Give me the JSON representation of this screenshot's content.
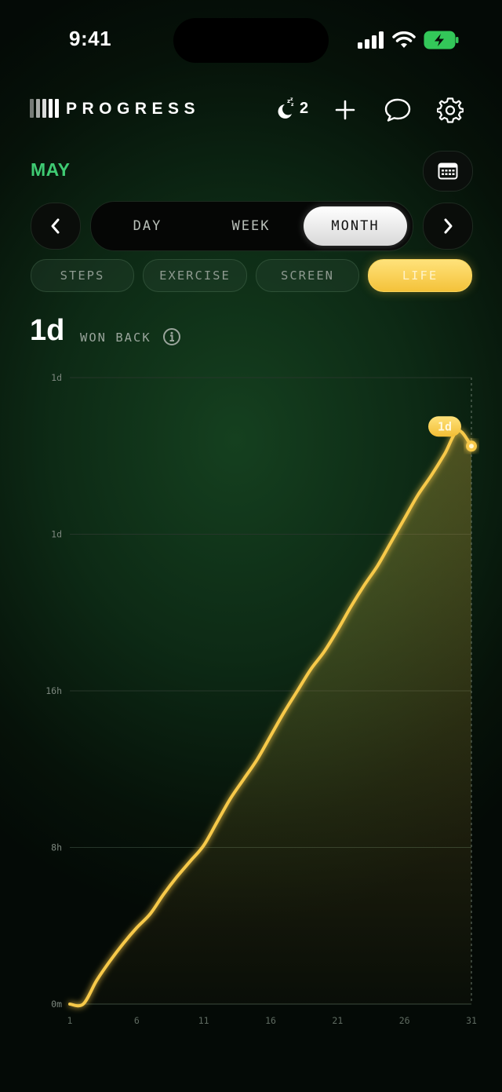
{
  "status_bar": {
    "time": "9:41"
  },
  "header": {
    "title": "PROGRESS",
    "sleep_count": "2",
    "icons": [
      "moon-sleep-icon",
      "plus-icon",
      "chat-bubble-icon",
      "gear-icon"
    ]
  },
  "period": {
    "month_label": "MAY",
    "tabs": [
      {
        "label": "DAY",
        "active": false
      },
      {
        "label": "WEEK",
        "active": false
      },
      {
        "label": "MONTH",
        "active": true
      }
    ]
  },
  "metrics": {
    "pills": [
      {
        "label": "STEPS",
        "active": false
      },
      {
        "label": "EXERCISE",
        "active": false
      },
      {
        "label": "SCREEN",
        "active": false
      },
      {
        "label": "LIFE",
        "active": true
      }
    ]
  },
  "summary": {
    "value": "1d",
    "caption": "WON BACK"
  },
  "colors": {
    "accent_green": "#3fcb73",
    "gold": "#f7c948"
  },
  "chart_data": {
    "type": "area",
    "title": "",
    "xlabel": "",
    "ylabel": "",
    "y_tick_labels": [
      "0m",
      "8h",
      "16h",
      "1d",
      "1d"
    ],
    "y_tick_values": [
      0,
      8,
      16,
      24,
      32
    ],
    "x_tick_labels": [
      "1",
      "6",
      "11",
      "16",
      "21",
      "26",
      "31"
    ],
    "x_tick_values": [
      1,
      6,
      11,
      16,
      21,
      26,
      31
    ],
    "ylim": [
      0,
      32
    ],
    "xlim": [
      1,
      31
    ],
    "grid": true,
    "last_value_label": "1d",
    "series": [
      {
        "x": [
          1,
          2,
          3,
          4,
          5,
          6,
          7,
          8,
          9,
          10,
          11,
          12,
          13,
          14,
          15,
          16,
          17,
          18,
          19,
          20,
          21,
          22,
          23,
          24,
          25,
          26,
          27,
          28,
          29,
          30,
          31
        ],
        "values": [
          0,
          0,
          1.2,
          2.2,
          3.1,
          3.9,
          4.6,
          5.6,
          6.5,
          7.3,
          8.1,
          9.3,
          10.5,
          11.5,
          12.5,
          13.7,
          14.9,
          16.0,
          17.1,
          18.0,
          19.1,
          20.3,
          21.4,
          22.4,
          23.6,
          24.8,
          26.0,
          27.0,
          28.1,
          29.3,
          28.5
        ]
      }
    ]
  }
}
